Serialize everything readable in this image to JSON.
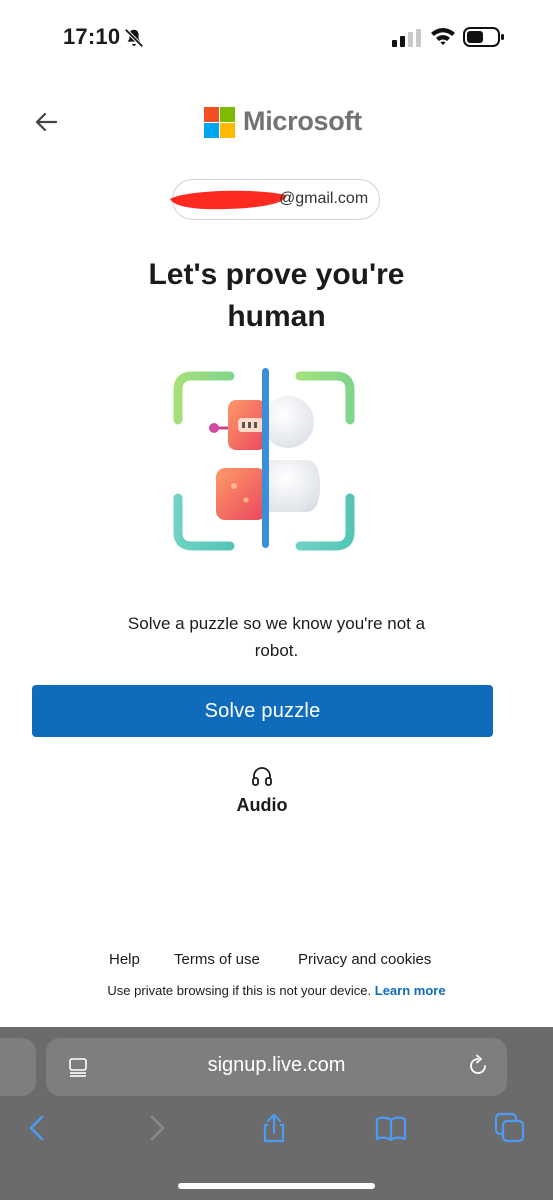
{
  "status_bar": {
    "time": "17:10"
  },
  "header": {
    "brand": "Microsoft"
  },
  "account": {
    "email_suffix": "@gmail.com"
  },
  "title": {
    "line1": "Let's prove you're",
    "line2": "human"
  },
  "description": {
    "line1": "Solve a puzzle so we know you're not a",
    "line2": "robot."
  },
  "actions": {
    "solve_label": "Solve puzzle",
    "audio_label": "Audio"
  },
  "footer": {
    "links": [
      "Help",
      "Terms of use",
      "Privacy and cookies"
    ],
    "note": "Use private browsing if this is not your device.",
    "learn_more": "Learn more"
  },
  "browser": {
    "url": "signup.live.com"
  },
  "colors": {
    "primary": "#0f6cbd",
    "ms_red": "#f25022",
    "ms_green": "#7fba00",
    "ms_blue": "#00a4ef",
    "ms_yellow": "#ffb900",
    "safari_bar": "#6b6b6b",
    "safari_blue": "#4c9bf5"
  }
}
